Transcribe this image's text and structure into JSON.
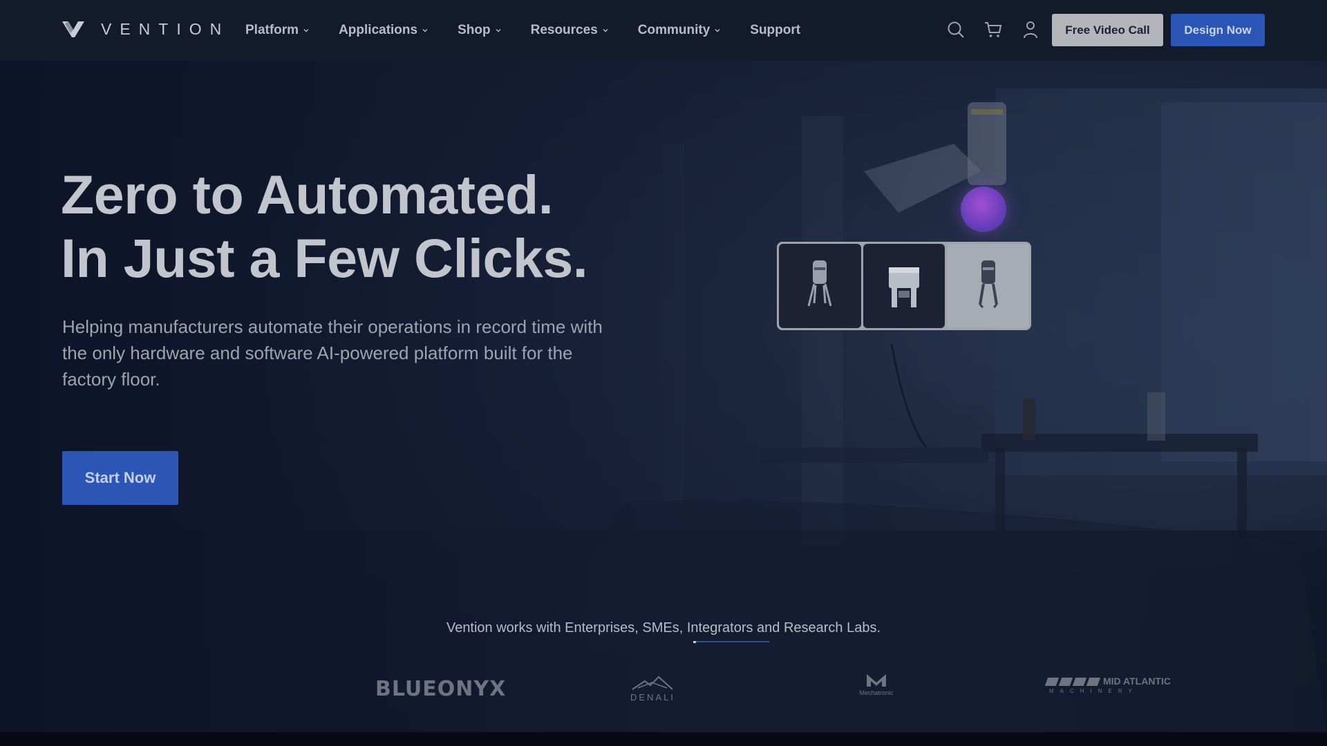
{
  "brand": {
    "name": "VENTION",
    "logo_icon": "vention-v-mark"
  },
  "nav": {
    "items": [
      {
        "label": "Platform",
        "has_dropdown": true
      },
      {
        "label": "Applications",
        "has_dropdown": true
      },
      {
        "label": "Shop",
        "has_dropdown": true
      },
      {
        "label": "Resources",
        "has_dropdown": true
      },
      {
        "label": "Community",
        "has_dropdown": true
      },
      {
        "label": "Support",
        "has_dropdown": false
      }
    ],
    "icons": [
      "search-icon",
      "cart-icon",
      "user-icon"
    ]
  },
  "header_actions": {
    "video_call_label": "Free Video Call",
    "design_now_label": "Design Now"
  },
  "hero": {
    "headline_line1": "Zero to Automated.",
    "headline_line2": "In Just a Few Clicks.",
    "subtext": "Helping manufacturers automate their operations in record time with the only hardware and software AI-powered platform built for the factory floor.",
    "cta_label": "Start Now"
  },
  "clients": {
    "intro": "Vention works with",
    "segments": "Enterprises, SMEs, Integrators and Research Labs.",
    "logos": {
      "bluonyx": "BLUEONYX",
      "denali": "DENALI",
      "mechatronic": "Mechatronic",
      "midatlantic": "MID ATLANTIC",
      "midatlantic_sub": "MACHINERY"
    }
  },
  "colors": {
    "header_bg": "#131a2c",
    "accent_blue": "#2b56b5",
    "orb_purple": "#8a45cc"
  }
}
